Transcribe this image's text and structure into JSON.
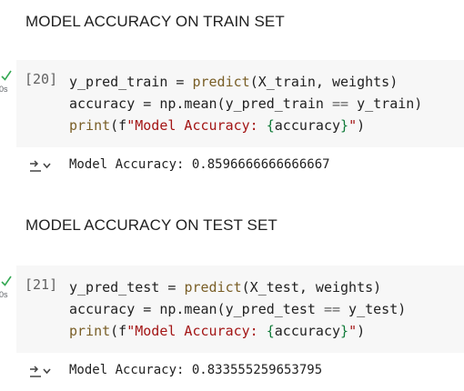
{
  "sections": [
    {
      "heading": "MODEL ACCURACY ON TRAIN SET",
      "cell": {
        "exec_count": "[20]",
        "duration": "0s",
        "line1": {
          "a": "y_pred_train = ",
          "fn": "predict",
          "b": "(X_train, weights)"
        },
        "line2": {
          "a": "accuracy = np.mean(y_pred_train ",
          "op": "==",
          "b": " y_train)"
        },
        "line3": {
          "fn": "print",
          "a": "(f",
          "s1": "\"Model Accuracy: ",
          "ob": "{",
          "var": "accuracy",
          "cb": "}",
          "s2": "\"",
          "end": ")"
        }
      },
      "output": "Model Accuracy: 0.8596666666666667"
    },
    {
      "heading": "MODEL ACCURACY ON TEST SET",
      "cell": {
        "exec_count": "[21]",
        "duration": "0s",
        "line1": {
          "a": "y_pred_test = ",
          "fn": "predict",
          "b": "(X_test, weights)"
        },
        "line2": {
          "a": "accuracy = np.mean(y_pred_test ",
          "op": "==",
          "b": " y_test)"
        },
        "line3": {
          "fn": "print",
          "a": "(f",
          "s1": "\"Model Accuracy: ",
          "ob": "{",
          "var": "accuracy",
          "cb": "}",
          "s2": "\"",
          "end": ")"
        }
      },
      "output": "Model Accuracy: 0.833555259653795"
    }
  ],
  "colors": {
    "cell_bg": "#f7f7f7",
    "check": "#34a853",
    "function": "#795e26",
    "string": "#a31515",
    "brace": "#0f7a38"
  },
  "icons": {
    "status": "check-icon",
    "output": "output-toggle-icon"
  }
}
